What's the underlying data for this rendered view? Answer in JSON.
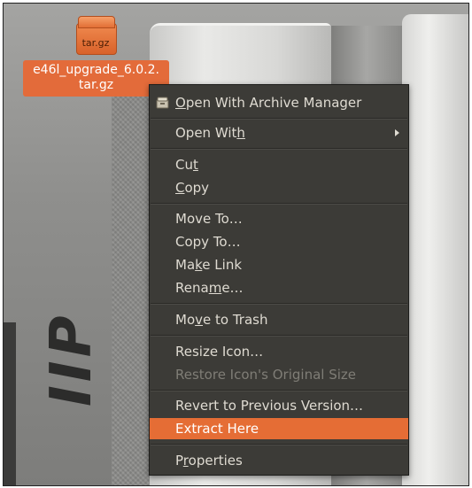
{
  "desktop": {
    "file": {
      "icon": "archive-icon",
      "extension_badge": "tar.gz",
      "name_line1": "e46l_upgrade_6.0.2.",
      "name_line2": "tar.gz"
    },
    "wallpaper_text": "IIP"
  },
  "context_menu": {
    "items": [
      {
        "id": "open-archive-manager",
        "pre": "",
        "u": "O",
        "post": "pen With Archive Manager",
        "icon": "archive-manager-icon",
        "enabled": true
      },
      {
        "id": "open-with",
        "pre": "Open Wit",
        "u": "h",
        "post": "",
        "submenu": true,
        "enabled": true
      },
      {
        "id": "cut",
        "pre": "Cu",
        "u": "t",
        "post": "",
        "enabled": true
      },
      {
        "id": "copy",
        "pre": "",
        "u": "C",
        "post": "opy",
        "enabled": true
      },
      {
        "id": "move-to",
        "pre": "Move To…",
        "u": "",
        "post": "",
        "enabled": true
      },
      {
        "id": "copy-to",
        "pre": "Copy To…",
        "u": "",
        "post": "",
        "enabled": true
      },
      {
        "id": "make-link",
        "pre": "Ma",
        "u": "k",
        "post": "e Link",
        "enabled": true
      },
      {
        "id": "rename",
        "pre": "Rena",
        "u": "m",
        "post": "e…",
        "enabled": true
      },
      {
        "id": "move-to-trash",
        "pre": "Mo",
        "u": "v",
        "post": "e to Trash",
        "enabled": true
      },
      {
        "id": "resize-icon",
        "pre": "Resize Icon…",
        "u": "",
        "post": "",
        "enabled": true
      },
      {
        "id": "restore-icon-size",
        "pre": "Restore Icon's Original Size",
        "u": "",
        "post": "",
        "enabled": false
      },
      {
        "id": "revert-previous-version",
        "pre": "Revert to Previous Version…",
        "u": "",
        "post": "",
        "enabled": true
      },
      {
        "id": "extract-here",
        "pre": "Extract Here",
        "u": "",
        "post": "",
        "enabled": true,
        "highlighted": true
      },
      {
        "id": "properties",
        "pre": "P",
        "u": "r",
        "post": "operties",
        "enabled": true
      }
    ]
  },
  "colors": {
    "menu_bg": "#3c3b37",
    "highlight": "#e56d35",
    "icon_label_bg": "#e36b3a",
    "menu_text": "#dfdbd2",
    "disabled_text": "#7f7d76"
  }
}
